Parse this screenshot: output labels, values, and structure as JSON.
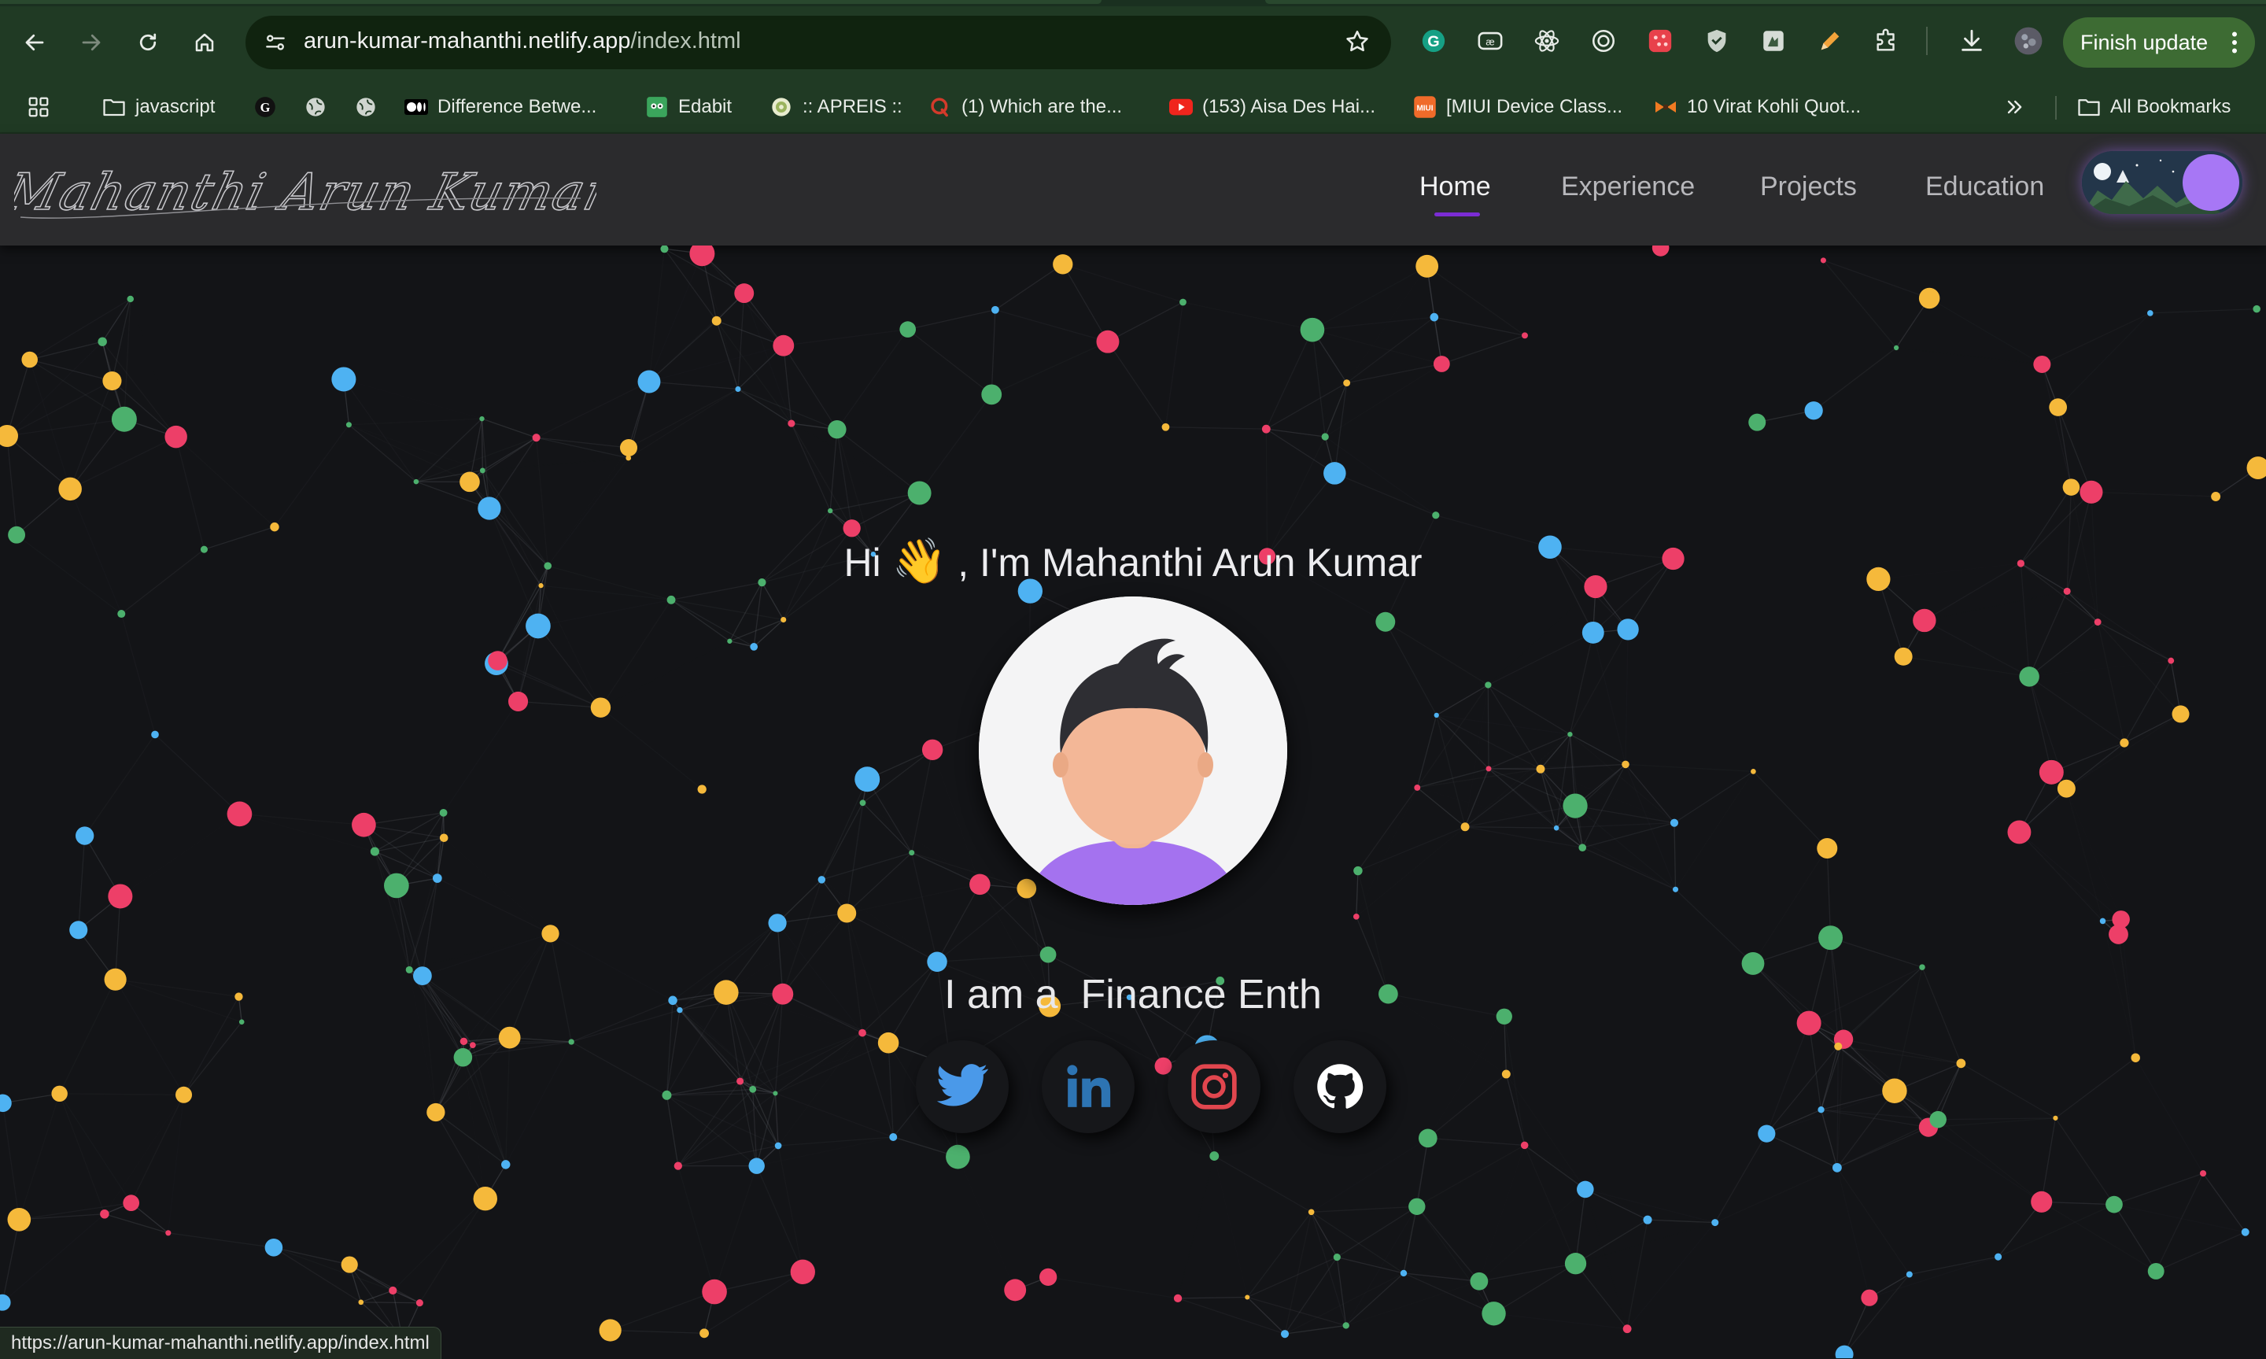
{
  "browser": {
    "url_host": "arun-kumar-mahanthi.netlify.app",
    "url_path": "/index.html",
    "update_button": "Finish update",
    "extensions": [
      "grammarly-icon",
      "cc-icon",
      "react-devtools-icon",
      "target-icon",
      "red-dots-icon",
      "shield-icon",
      "bird-icon",
      "pencil-icon",
      "puzzle-icon"
    ],
    "bookmarks": [
      {
        "icon": "folder-icon",
        "label": "javascript"
      },
      {
        "icon": "g-logo-icon",
        "label": ""
      },
      {
        "icon": "globe-icon",
        "label": ""
      },
      {
        "icon": "globe-icon",
        "label": ""
      },
      {
        "icon": "medium-icon",
        "label": "Difference Betwe..."
      },
      {
        "icon": "edabit-icon",
        "label": "Edabit"
      },
      {
        "icon": "apreis-icon",
        "label": ":: APREIS ::"
      },
      {
        "icon": "quora-icon",
        "label": "(1) Which are the..."
      },
      {
        "icon": "youtube-icon",
        "label": "(153) Aisa Des Hai..."
      },
      {
        "icon": "miui-icon",
        "label": "[MIUI Device Class..."
      },
      {
        "icon": "bow-icon",
        "label": "10 Virat Kohli Quot..."
      }
    ],
    "all_bookmarks": "All Bookmarks",
    "status_url": "https://arun-kumar-mahanthi.netlify.app/index.html"
  },
  "site": {
    "logo_text": "Mahanthi Arun Kumar",
    "nav": [
      {
        "label": "Home",
        "active": true
      },
      {
        "label": "Experience",
        "active": false
      },
      {
        "label": "Projects",
        "active": false
      },
      {
        "label": "Education",
        "active": false
      }
    ],
    "greeting_prefix": "Hi",
    "greeting_emoji": "👋",
    "greeting_rest": ", I'm Mahanthi Arun Kumar",
    "typed_text": "I am a  Finance Enth",
    "socials": [
      {
        "name": "twitter-icon",
        "color": "#4a99e9"
      },
      {
        "name": "linkedin-icon",
        "color": "#2d74b3"
      },
      {
        "name": "instagram-icon",
        "color": "#e1464e"
      },
      {
        "name": "github-icon",
        "color": "#ffffff"
      }
    ],
    "network_colors": [
      "#ed3f68",
      "#f5b93b",
      "#4eb2f2",
      "#4cb06d"
    ]
  }
}
